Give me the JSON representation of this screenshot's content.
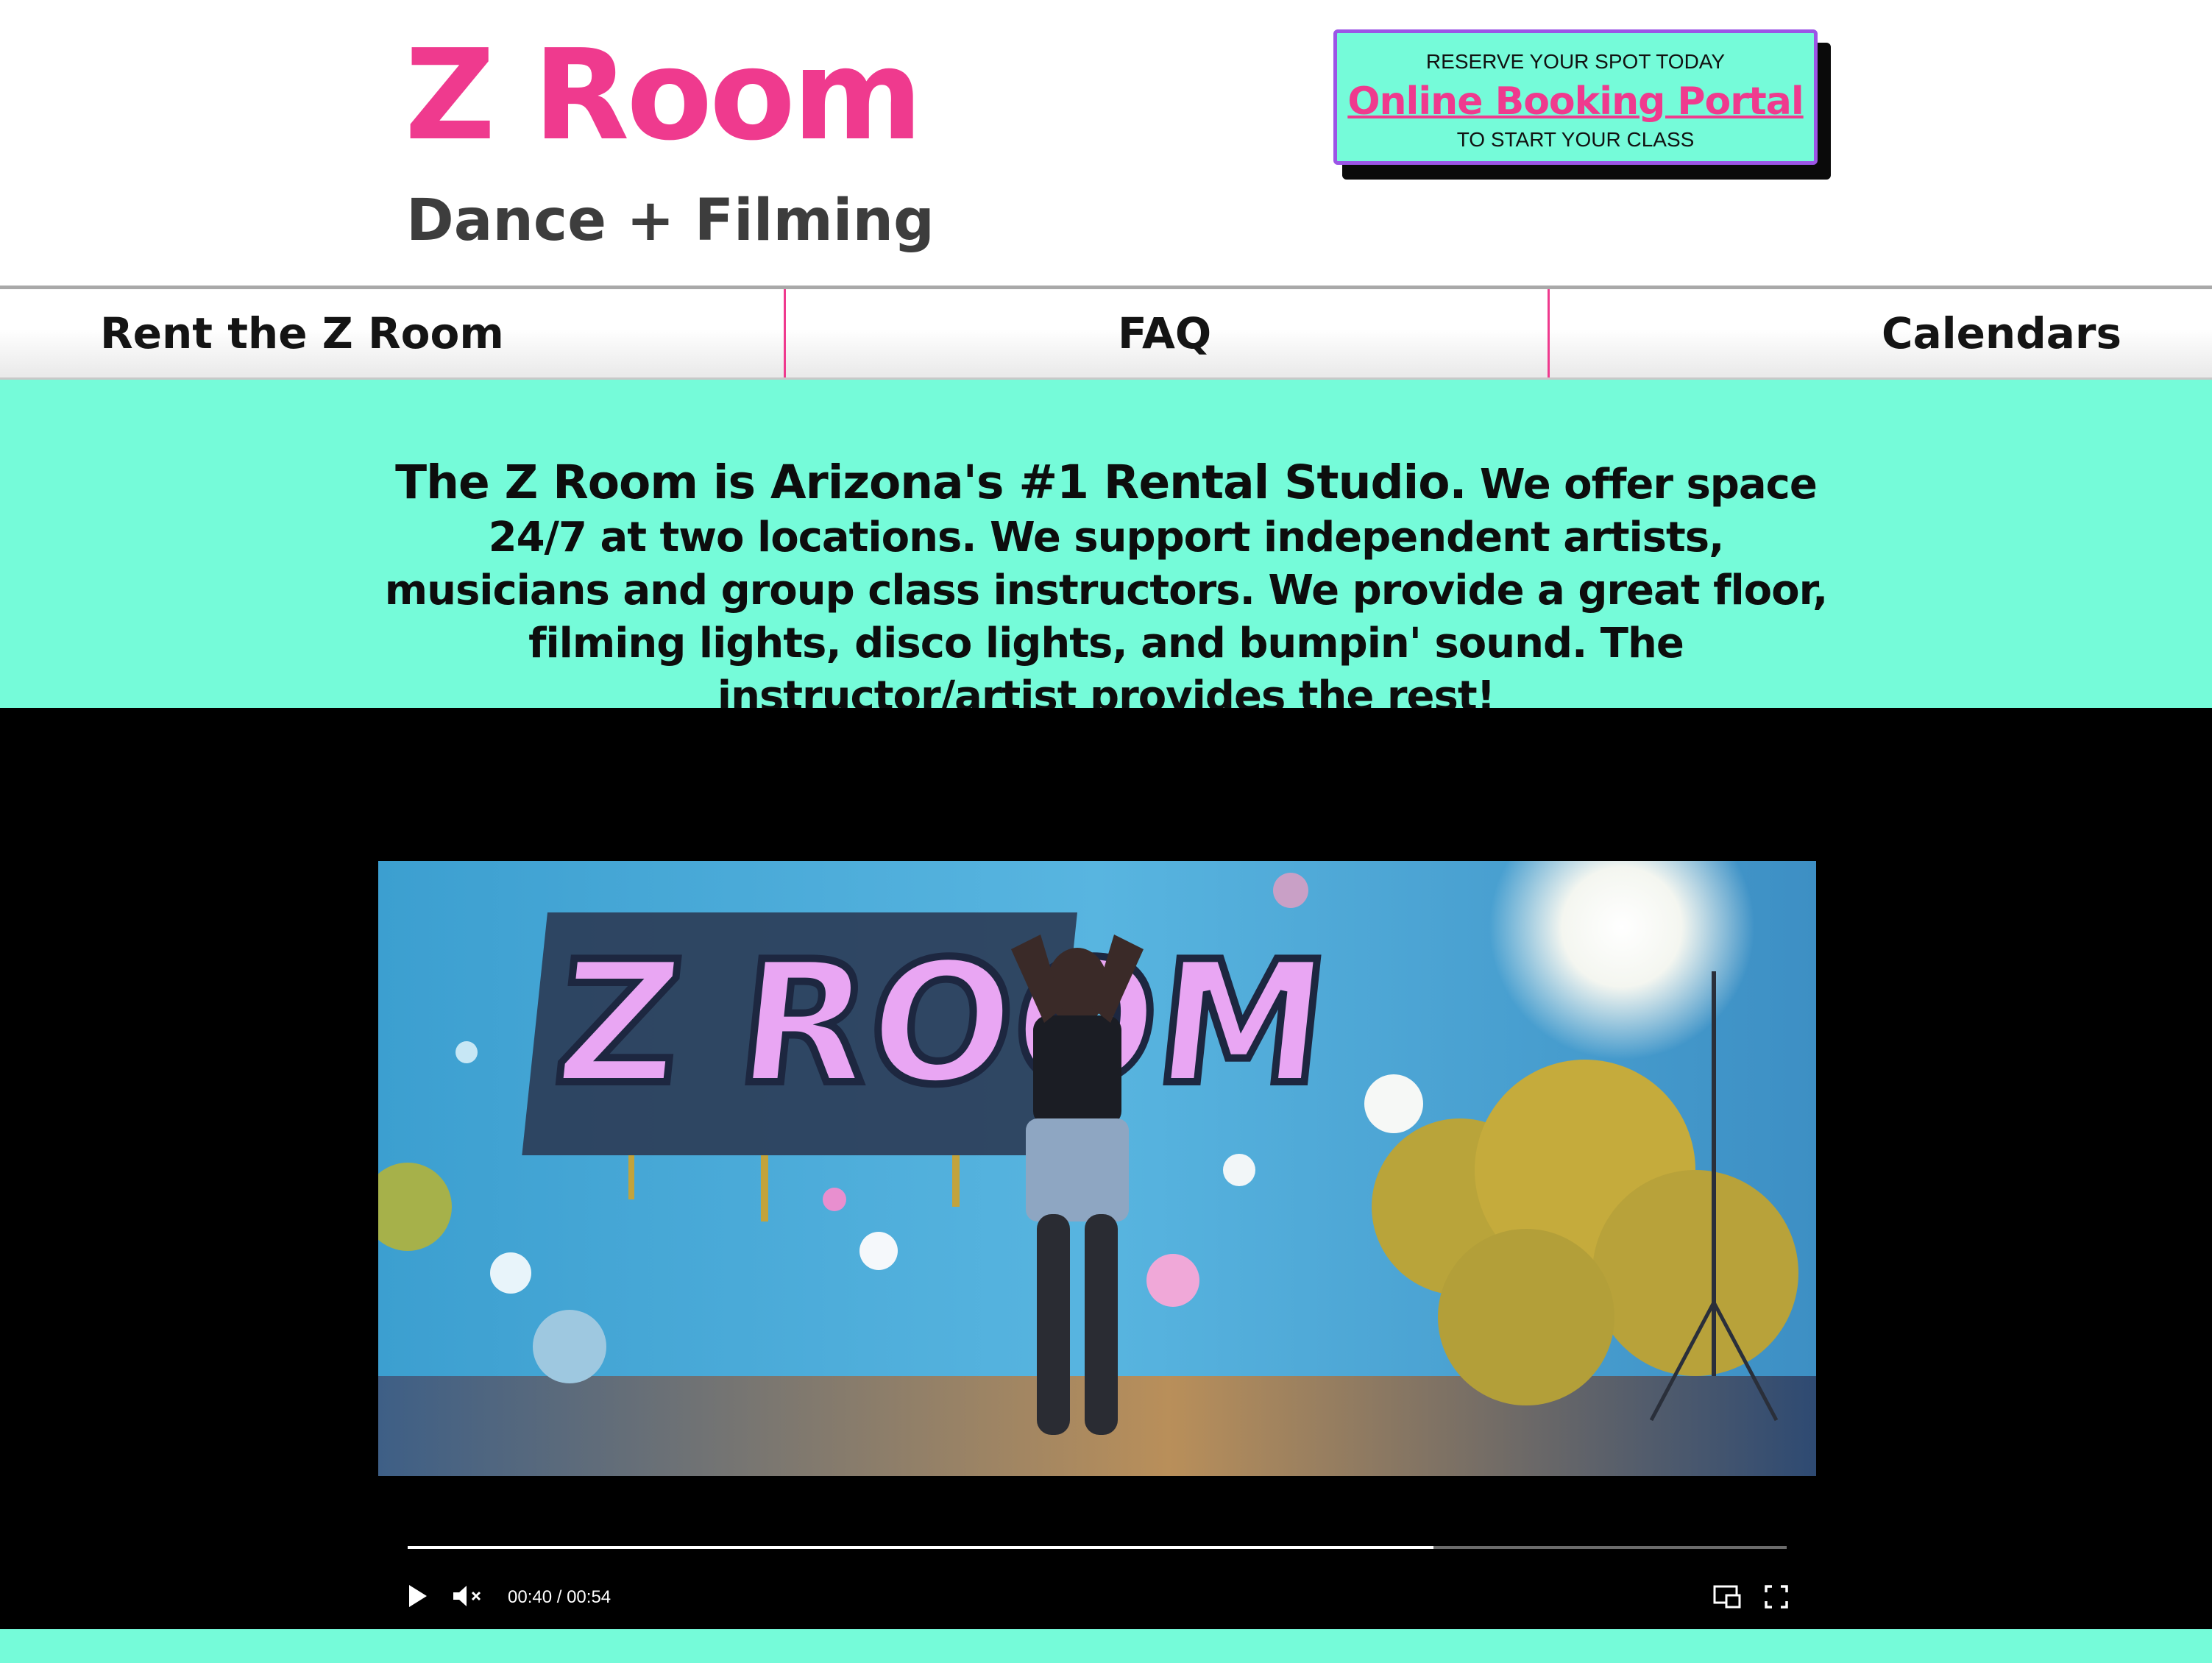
{
  "header": {
    "brand_title": "Z Room",
    "brand_subtitle": "Dance + Filming",
    "cta": {
      "top_text": "RESERVE YOUR SPOT TODAY",
      "link_text": "Online Booking Portal",
      "bottom_text": "TO START YOUR CLASS"
    }
  },
  "nav": {
    "items": [
      {
        "label": "Rent the Z Room"
      },
      {
        "label": "FAQ"
      },
      {
        "label": "Calendars"
      }
    ]
  },
  "intro": {
    "lead": "The Z Room is Arizona's #1 Rental Studio.",
    "body": " We offer space 24/7 at two locations.  We support independent artists, musicians and group class instructors. We provide a great floor, filming lights, disco lights, and bumpin' sound. The instructor/artist provides the rest!"
  },
  "video": {
    "wall_sign_text": "Z ROOM",
    "current_time": "00:40",
    "duration": "00:54",
    "time_separator": " / ",
    "progress_fraction": 0.744,
    "muted": true,
    "icons": {
      "play": "play-icon",
      "mute": "muted-speaker-icon",
      "pip": "picture-in-picture-icon",
      "fullscreen": "fullscreen-icon"
    }
  },
  "colors": {
    "brand_pink": "#ef3a8e",
    "mint": "#75fbd9",
    "purple_border": "#9c55e6",
    "dark_text": "#3d3d3d",
    "video_bg": "#000000"
  }
}
